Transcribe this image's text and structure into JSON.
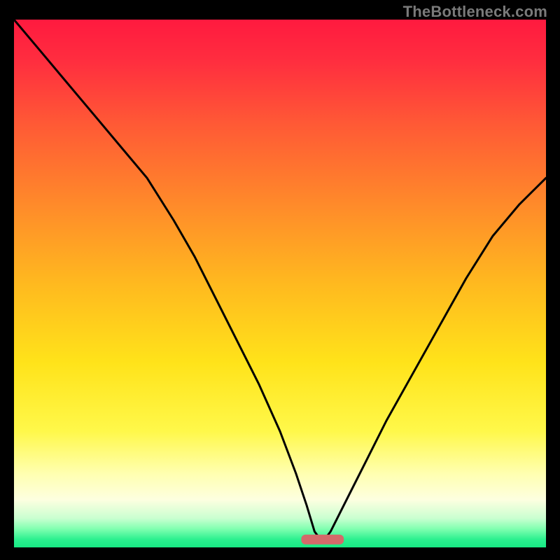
{
  "watermark": "TheBottleneck.com",
  "colors": {
    "frame": "#000000",
    "curve": "#000000",
    "marker": "#d46a6a",
    "gradient_stops": [
      {
        "offset": 0.0,
        "color": "#ff1a3f"
      },
      {
        "offset": 0.08,
        "color": "#ff2e3f"
      },
      {
        "offset": 0.2,
        "color": "#ff5a35"
      },
      {
        "offset": 0.35,
        "color": "#ff8a2a"
      },
      {
        "offset": 0.5,
        "color": "#ffb91f"
      },
      {
        "offset": 0.65,
        "color": "#ffe31a"
      },
      {
        "offset": 0.78,
        "color": "#fff84a"
      },
      {
        "offset": 0.86,
        "color": "#ffffb0"
      },
      {
        "offset": 0.91,
        "color": "#fdffe0"
      },
      {
        "offset": 0.945,
        "color": "#c9ffd0"
      },
      {
        "offset": 0.965,
        "color": "#80ffb0"
      },
      {
        "offset": 0.985,
        "color": "#2bf08f"
      },
      {
        "offset": 1.0,
        "color": "#18e884"
      }
    ]
  },
  "chart_data": {
    "type": "line",
    "title": "",
    "xlabel": "",
    "ylabel": "",
    "xlim": [
      0,
      100
    ],
    "ylim": [
      0,
      100
    ],
    "grid": false,
    "legend": false,
    "annotations": [],
    "marker": {
      "x_center": 58,
      "width": 8,
      "y": 1.5
    },
    "series": [
      {
        "name": "curve",
        "x": [
          0,
          5,
          10,
          15,
          20,
          25,
          30,
          34,
          38,
          42,
          46,
          50,
          53,
          55,
          56.5,
          58,
          59.5,
          62,
          66,
          70,
          75,
          80,
          85,
          90,
          95,
          100
        ],
        "values": [
          100,
          94,
          88,
          82,
          76,
          70,
          62,
          55,
          47,
          39,
          31,
          22,
          14,
          8,
          3,
          1,
          3,
          8,
          16,
          24,
          33,
          42,
          51,
          59,
          65,
          70
        ]
      }
    ]
  }
}
